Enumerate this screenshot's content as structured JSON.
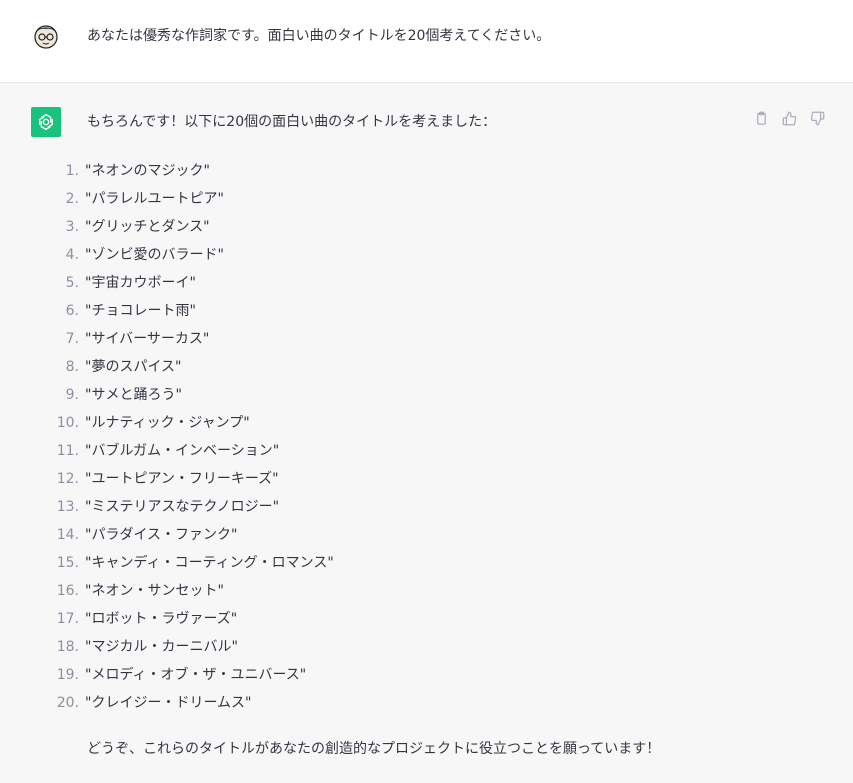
{
  "user_message": {
    "text": "あなたは優秀な作詞家です。面白い曲のタイトルを20個考えてください。",
    "avatar_icon": "user-avatar-icon"
  },
  "assistant_message": {
    "avatar_icon": "openai-logo-icon",
    "intro": "もちろんです！以下に20個の面白い曲のタイトルを考えました：",
    "songs": [
      {
        "num": "1.",
        "title": "\"ネオンのマジック\""
      },
      {
        "num": "2.",
        "title": "\"パラレルユートピア\""
      },
      {
        "num": "3.",
        "title": "\"グリッチとダンス\""
      },
      {
        "num": "4.",
        "title": "\"ゾンビ愛のバラード\""
      },
      {
        "num": "5.",
        "title": "\"宇宙カウボーイ\""
      },
      {
        "num": "6.",
        "title": "\"チョコレート雨\""
      },
      {
        "num": "7.",
        "title": "\"サイバーサーカス\""
      },
      {
        "num": "8.",
        "title": "\"夢のスパイス\""
      },
      {
        "num": "9.",
        "title": "\"サメと踊ろう\""
      },
      {
        "num": "10.",
        "title": "\"ルナティック・ジャンプ\""
      },
      {
        "num": "11.",
        "title": "\"バブルガム・インベーション\""
      },
      {
        "num": "12.",
        "title": "\"ユートピアン・フリーキーズ\""
      },
      {
        "num": "13.",
        "title": "\"ミステリアスなテクノロジー\""
      },
      {
        "num": "14.",
        "title": "\"パラダイス・ファンク\""
      },
      {
        "num": "15.",
        "title": "\"キャンディ・コーティング・ロマンス\""
      },
      {
        "num": "16.",
        "title": "\"ネオン・サンセット\""
      },
      {
        "num": "17.",
        "title": "\"ロボット・ラヴァーズ\""
      },
      {
        "num": "18.",
        "title": "\"マジカル・カーニバル\""
      },
      {
        "num": "19.",
        "title": "\"メロディ・オブ・ザ・ユニバース\""
      },
      {
        "num": "20.",
        "title": "\"クレイジー・ドリームス\""
      }
    ],
    "outro": "どうぞ、これらのタイトルがあなたの創造的なプロジェクトに役立つことを願っています！",
    "actions": [
      {
        "name": "copy-button",
        "icon": "clipboard-icon"
      },
      {
        "name": "thumbs-up-button",
        "icon": "thumbs-up-icon"
      },
      {
        "name": "thumbs-down-button",
        "icon": "thumbs-down-icon"
      }
    ]
  },
  "colors": {
    "assistant_bg": "#f7f7f8",
    "avatar_green": "#19c37d",
    "text": "#343541",
    "muted": "#8e8ea0"
  }
}
